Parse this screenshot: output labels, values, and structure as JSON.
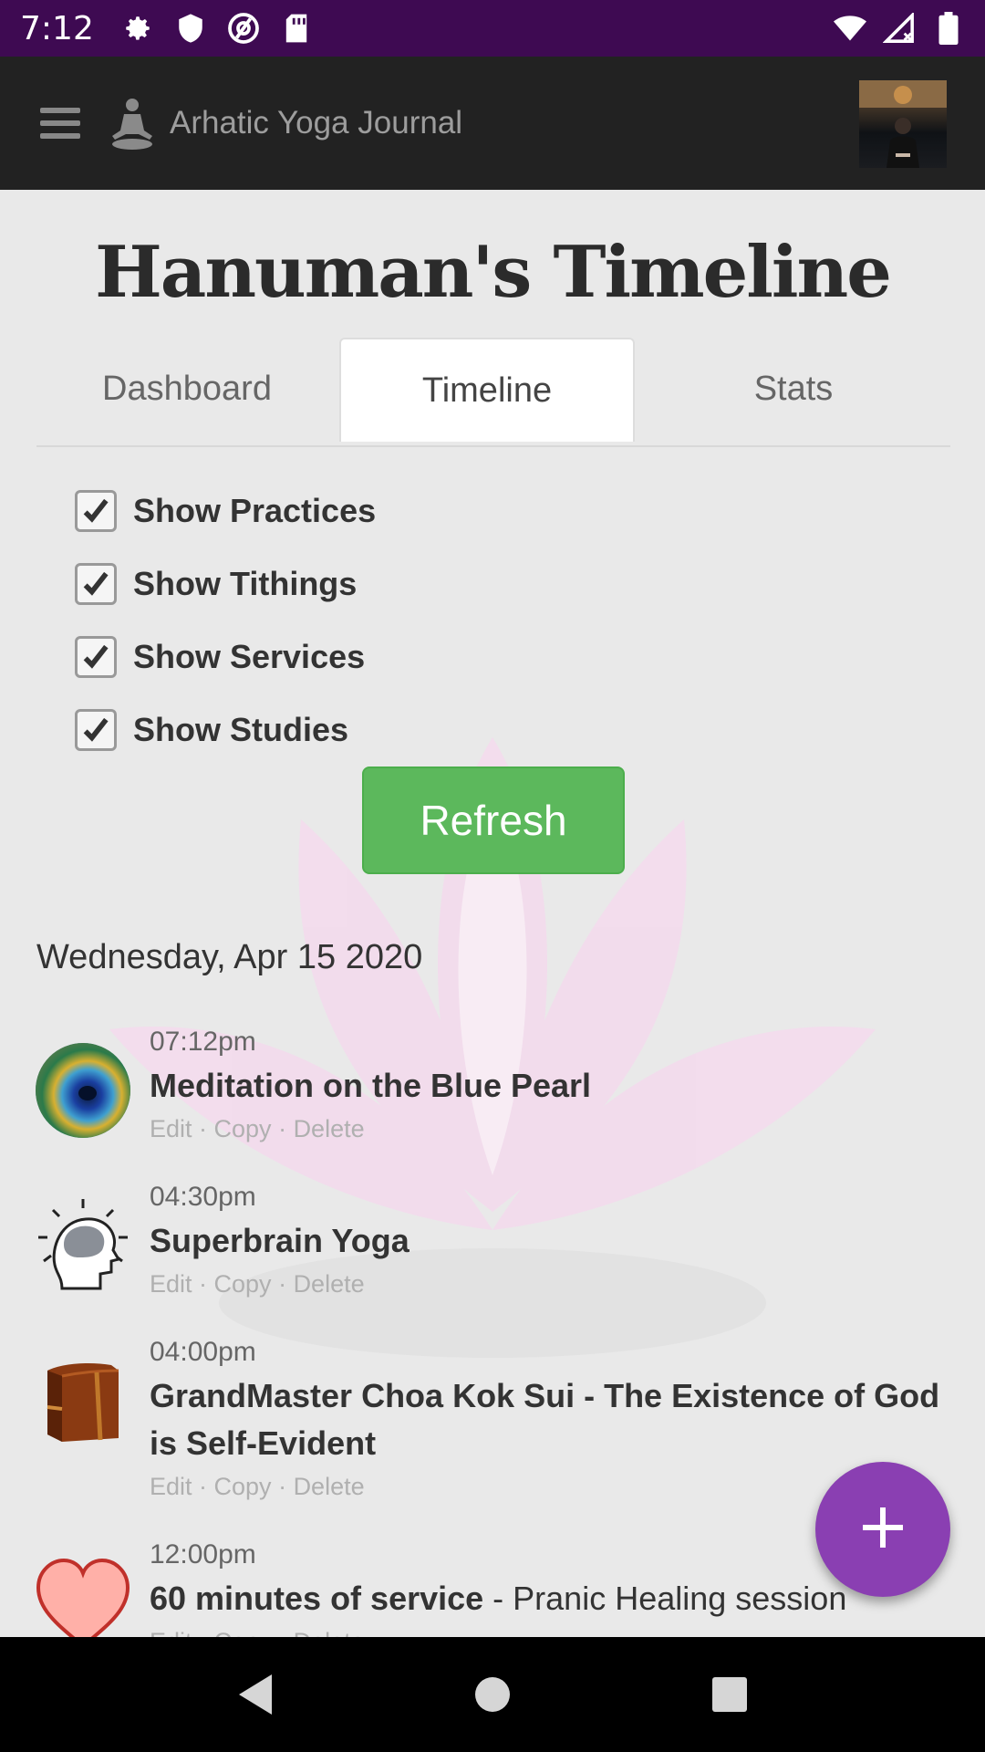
{
  "status_bar": {
    "time": "7:12",
    "icons": [
      "settings-icon",
      "shield-icon",
      "at-sign-icon",
      "sd-card-icon",
      "wifi-icon",
      "signal-icon",
      "battery-icon"
    ]
  },
  "app_bar": {
    "title": "Arhatic Yoga Journal",
    "menu_icon": "hamburger-menu-icon",
    "logo_icon": "meditation-figure-icon"
  },
  "page": {
    "title": "Hanuman's Timeline"
  },
  "tabs": [
    {
      "label": "Dashboard",
      "active": false
    },
    {
      "label": "Timeline",
      "active": true
    },
    {
      "label": "Stats",
      "active": false
    }
  ],
  "filters": [
    {
      "label": "Show Practices",
      "checked": true
    },
    {
      "label": "Show Tithings",
      "checked": true
    },
    {
      "label": "Show Services",
      "checked": true
    },
    {
      "label": "Show Studies",
      "checked": true
    }
  ],
  "refresh_label": "Refresh",
  "date_heading": "Wednesday, Apr 15 2020",
  "actions": {
    "edit": "Edit",
    "copy": "Copy",
    "delete": "Delete",
    "sep": " · "
  },
  "entries": [
    {
      "time": "07:12pm",
      "name": "Meditation on the Blue Pearl",
      "sub": "",
      "icon": "peacock-feather-icon"
    },
    {
      "time": "04:30pm",
      "name": "Superbrain Yoga",
      "sub": "",
      "icon": "brain-head-icon"
    },
    {
      "time": "04:00pm",
      "name": "GrandMaster Choa Kok Sui - The Existence of God is Self-Evident",
      "sub": "",
      "icon": "book-icon"
    },
    {
      "time": "12:00pm",
      "name": "60 minutes of service",
      "sub": " - Pranic Healing session",
      "icon": "heart-icon"
    }
  ],
  "fab_icon": "plus-icon",
  "colors": {
    "status_bar": "#3e0a52",
    "app_bar": "#222222",
    "refresh": "#5cb85c",
    "fab": "#8a3fb2"
  }
}
